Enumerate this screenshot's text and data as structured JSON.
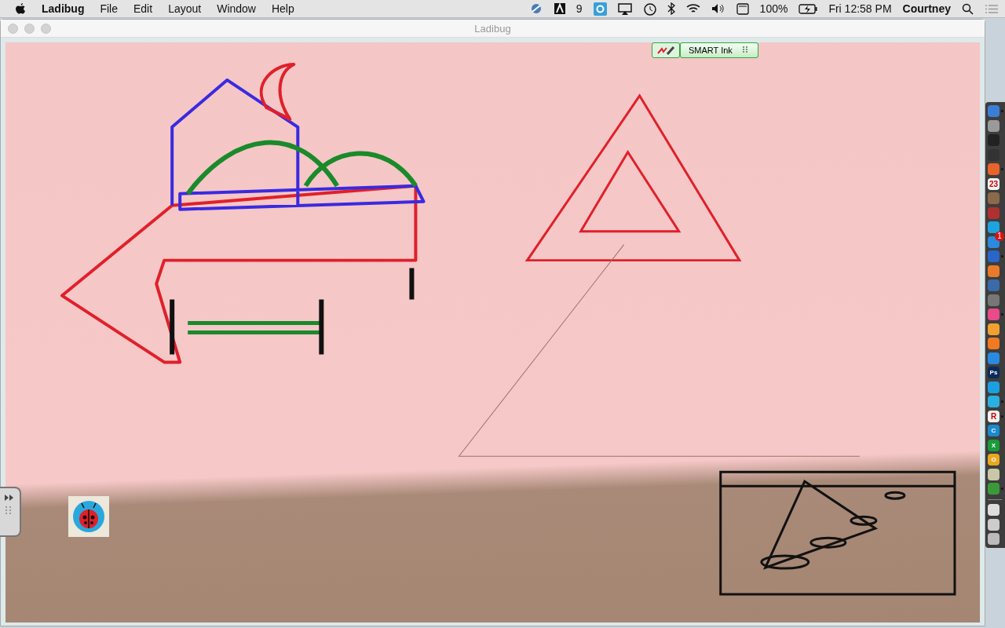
{
  "menubar": {
    "app_name": "Ladibug",
    "menus": [
      "File",
      "Edit",
      "Layout",
      "Window",
      "Help"
    ],
    "adobe_count": "9",
    "battery": "100%",
    "clock": "Fri 12:58 PM",
    "user": "Courtney"
  },
  "window": {
    "title": "Ladibug"
  },
  "smart_ink": {
    "label": "SMART Ink"
  },
  "dock": {
    "items": [
      {
        "running": true
      },
      {
        "running": false
      },
      {
        "running": false
      },
      {
        "running": false
      },
      {
        "running": true
      },
      {
        "running": false,
        "label": "23"
      },
      {
        "running": false
      },
      {
        "running": false
      },
      {
        "running": false
      },
      {
        "running": false,
        "badge": "1"
      },
      {
        "running": true
      },
      {
        "running": false
      },
      {
        "running": false
      },
      {
        "running": false
      },
      {
        "running": true
      },
      {
        "running": false
      },
      {
        "running": false
      },
      {
        "running": false
      },
      {
        "running": false,
        "label": "Ps"
      },
      {
        "running": false
      },
      {
        "running": true
      },
      {
        "running": true,
        "label": "R"
      },
      {
        "running": false,
        "label": "C"
      },
      {
        "running": false,
        "label": "X"
      },
      {
        "running": false,
        "label": "O"
      },
      {
        "running": false
      },
      {
        "running": true
      }
    ],
    "stack_items": [
      {
        "running": false
      },
      {
        "running": false
      },
      {
        "running": false
      }
    ]
  }
}
